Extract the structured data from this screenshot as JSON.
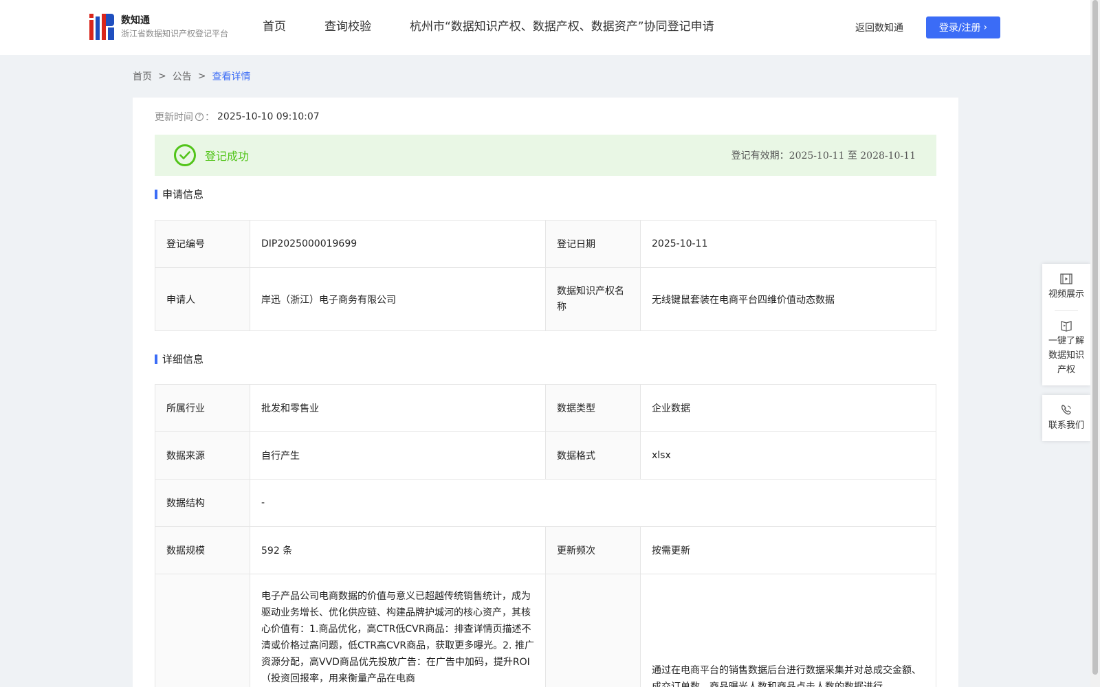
{
  "header": {
    "logo_title": "数知通",
    "logo_subtitle": "浙江省数据知识产权登记平台",
    "nav": [
      "首页",
      "查询校验",
      "杭州市“数据知识产权、数据产权、数据资产”协同登记申请"
    ],
    "back_label": "返回数知通",
    "login_label": "登录/注册"
  },
  "breadcrumb": {
    "home": "首页",
    "notice": "公告",
    "current": "查看详情",
    "separator": ">"
  },
  "update": {
    "label": "更新时间",
    "value": "2025-10-10 09:10:07"
  },
  "status": {
    "text": "登记成功",
    "validity_label": "登记有效期：",
    "validity_value": "2025-10-11 至 2028-10-11",
    "color": "#52c41a"
  },
  "application": {
    "title": "申请信息",
    "reg_no_label": "登记编号",
    "reg_no": "DIP2025000019699",
    "reg_date_label": "登记日期",
    "reg_date": "2025-10-11",
    "applicant_label": "申请人",
    "applicant": "岸迅（浙江）电子商务有限公司",
    "ip_name_label": "数据知识产权名称",
    "ip_name": "无线键鼠套装在电商平台四维价值动态数据"
  },
  "detail": {
    "title": "详细信息",
    "industry_label": "所属行业",
    "industry": "批发和零售业",
    "type_label": "数据类型",
    "type": "企业数据",
    "source_label": "数据来源",
    "source": "自行产生",
    "format_label": "数据格式",
    "format": "xlsx",
    "structure_label": "数据结构",
    "structure": "-",
    "scale_label": "数据规模",
    "scale": "592 条",
    "freq_label": "更新频次",
    "freq": "按需更新",
    "description": "电子产品公司电商数据的价值与意义已超越传统销售统计，成为驱动业务增长、优化供应链、构建品牌护城河的核心资产，其核心价值有：1.商品优化，高CTR低CVR商品：排查详情页描述不清或价格过高问题，低CTR高CVR商品，获取更多曝光。2. 推广资源分配，高VVD商品优先投放广告：在广告中加码，提升ROI（投资回报率，用来衡量产品在电商",
    "method": "通过在电商平台的销售数据后台进行数据采集并对总成交金额、成交订单数、商品曝光人数和商品点击人数的数据进行"
  },
  "float_panel": {
    "video": "视频展示",
    "learn": "一键了解数据知识产权",
    "contact": "联系我们"
  },
  "colors": {
    "primary": "#3b6cf6",
    "success_bg": "#e9f7e5",
    "logo_red": "#d9261c",
    "logo_blue": "#1f4fbf"
  }
}
